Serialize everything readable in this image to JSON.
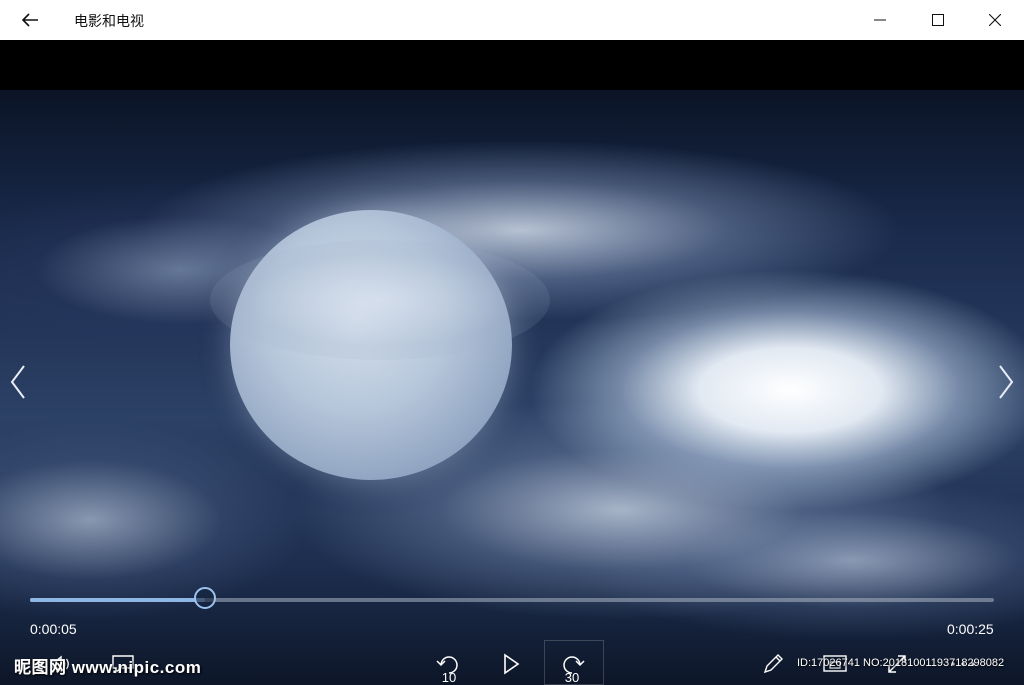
{
  "window": {
    "title": "电影和电视"
  },
  "player": {
    "current_time": "0:00:05",
    "duration": "0:00:25",
    "progress_fraction": 0.182,
    "skip_back_seconds": "10",
    "skip_forward_seconds": "30"
  },
  "watermark": {
    "left": "昵图网 www.nipic.com",
    "right": "ID:17026741 NO:20181001193718298082"
  },
  "colors": {
    "accent": "#8fb7e6",
    "titlebar_bg": "#ffffff"
  },
  "icons": [
    "back-arrow-icon",
    "minimize-icon",
    "maximize-icon",
    "close-icon",
    "chevron-left-icon",
    "chevron-right-icon",
    "volume-icon",
    "subtitles-icon",
    "skip-back-icon",
    "play-icon",
    "skip-forward-icon",
    "pencil-icon",
    "cast-icon",
    "fullscreen-icon",
    "more-icon"
  ]
}
